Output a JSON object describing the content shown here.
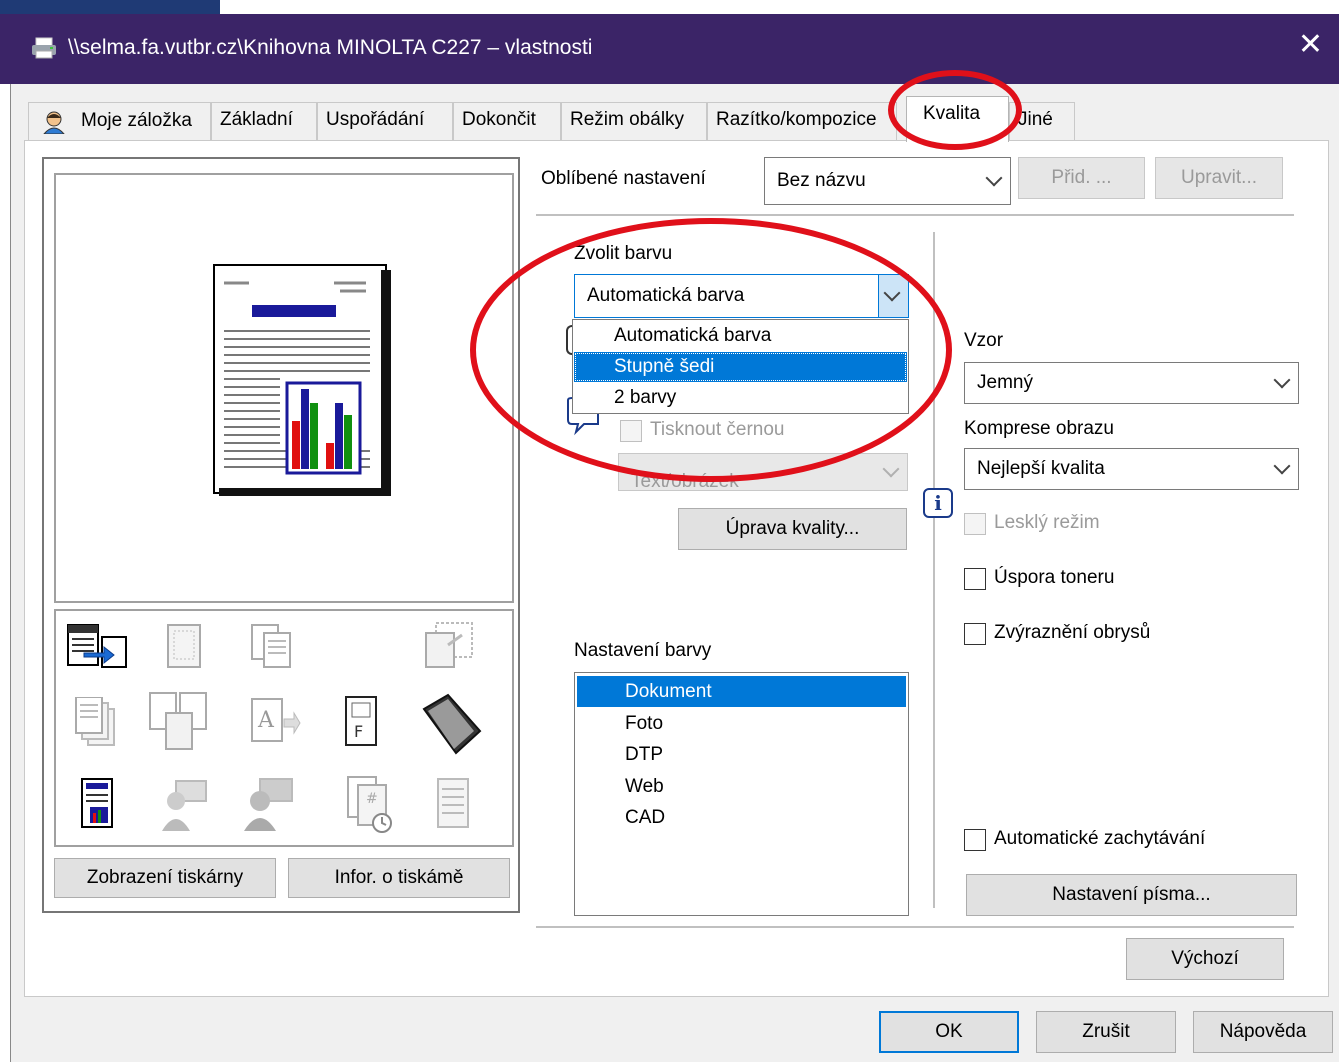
{
  "window": {
    "title": "\\\\selma.fa.vutbr.cz\\Knihovna MINOLTA C227 – vlastnosti",
    "close_glyph": "✕"
  },
  "tabs": [
    {
      "label": "Moje záložka",
      "icon": "user-icon"
    },
    {
      "label": "Základní"
    },
    {
      "label": "Uspořádání"
    },
    {
      "label": "Dokončit"
    },
    {
      "label": "Režim obálky"
    },
    {
      "label": "Razítko/kompozice"
    },
    {
      "label": "Kvalita",
      "active": true
    },
    {
      "label": "Jiné"
    }
  ],
  "favorites": {
    "label": "Oblíbené nastavení",
    "value": "Bez názvu",
    "add_label": "Přid. ...",
    "edit_label": "Upravit..."
  },
  "color_select": {
    "label": "Zvolit barvu",
    "value": "Automatická barva",
    "options": [
      "Automatická barva",
      "Stupně šedi",
      "2 barvy"
    ],
    "highlighted": "Stupně šedi"
  },
  "black_print": {
    "label": "Tisknout černou",
    "checked": false,
    "disabled": true,
    "select_value": "Text/obrázek"
  },
  "quality_adjust_label": "Úprava kvality...",
  "color_settings": {
    "label": "Nastavení barvy",
    "items": [
      "Dokument",
      "Foto",
      "DTP",
      "Web",
      "CAD"
    ],
    "selected": "Dokument"
  },
  "pattern": {
    "label": "Vzor",
    "value": "Jemný"
  },
  "compression": {
    "label": "Komprese obrazu",
    "value": "Nejlepší kvalita"
  },
  "glossy": {
    "label": "Lesklý režim",
    "checked": false,
    "disabled": true
  },
  "toner_save": {
    "label": "Úspora toneru",
    "checked": false
  },
  "edge_enhance": {
    "label": "Zvýraznění obrysů",
    "checked": false
  },
  "auto_trapping": {
    "label": "Automatické zachytávání",
    "checked": false
  },
  "font_settings_label": "Nastavení písma...",
  "default_label": "Výchozí",
  "preview_buttons": {
    "printer_view": "Zobrazení tiskárny",
    "printer_info": "Infor. o tiskámě"
  },
  "footer": {
    "ok": "OK",
    "cancel": "Zrušit",
    "help": "Nápověda"
  },
  "colors": {
    "accent": "#0078d7",
    "titlebar": "#3b2467",
    "annotation": "#e0101a"
  }
}
